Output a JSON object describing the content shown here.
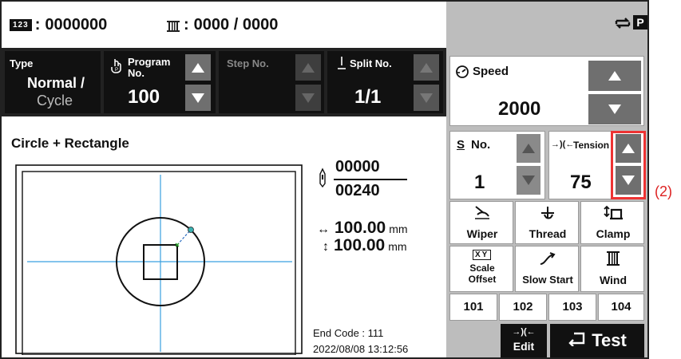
{
  "topbar": {
    "counter_badge": "123",
    "counter_value": "0000000",
    "bobbin_value": "0000 / 0000",
    "repeat_icon": "repeat-icon",
    "p_icon_label": "P"
  },
  "info_row": {
    "type_label": "Type",
    "type_value": "Normal /",
    "type_value2": "Cycle",
    "program_label": "Program",
    "program_label2": "No.",
    "program_value": "100",
    "step_label": "Step No.",
    "split_label": "Split No.",
    "split_value": "1/1"
  },
  "pattern": {
    "title": "Circle + Rectangle",
    "stitch_current": "00000",
    "stitch_total": "00240",
    "size_x": "100.00",
    "size_y": "100.00",
    "unit": "mm",
    "end_code": "End Code : 111",
    "datetime": "2022/08/08 13:12:56"
  },
  "speed": {
    "label": "Speed",
    "value": "2000"
  },
  "s_no": {
    "label": "No.",
    "prefix": "S",
    "value": "1"
  },
  "tension": {
    "label": "Tension",
    "value": "75"
  },
  "functions": {
    "wiper": "Wiper",
    "thread": "Thread",
    "clamp": "Clamp",
    "scale_offset_1": "Scale",
    "scale_offset_2": "Offset",
    "scale_badge": "XY",
    "slow_start": "Slow Start",
    "wind": "Wind"
  },
  "shortcuts": [
    "101",
    "102",
    "103",
    "104"
  ],
  "bottom": {
    "edit_label": "Edit",
    "test_label": "Test"
  },
  "annotation": "(2)"
}
